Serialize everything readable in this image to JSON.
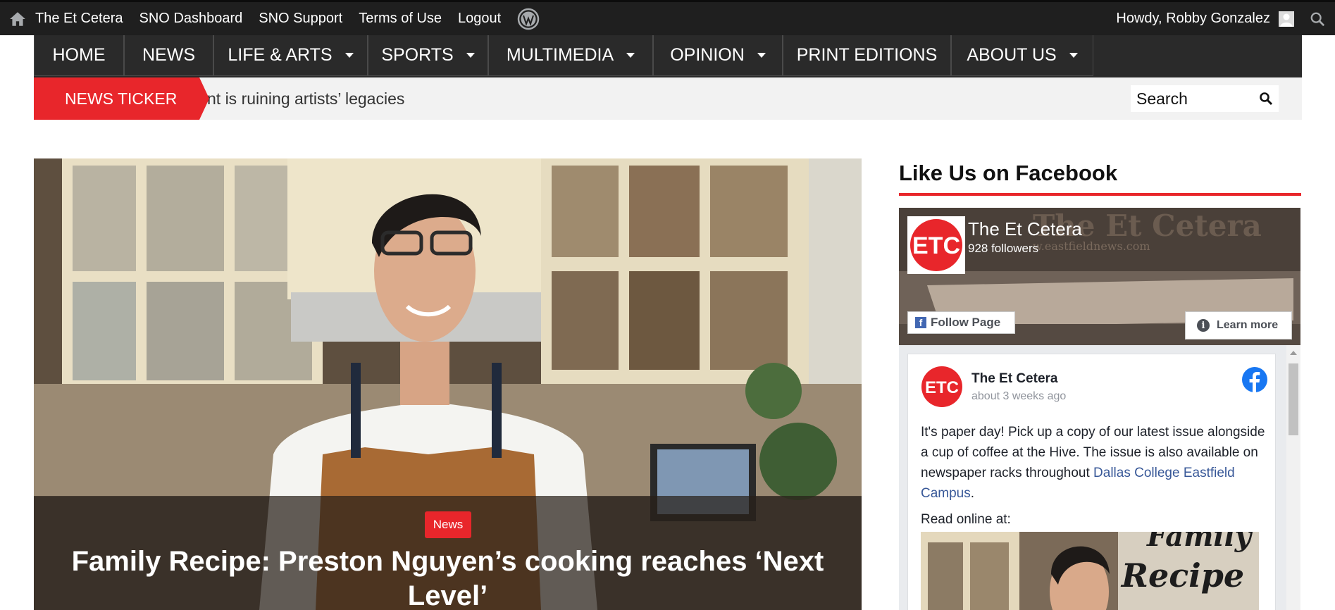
{
  "admin_bar": {
    "links": [
      "The Et Cetera",
      "SNO Dashboard",
      "SNO Support",
      "Terms of Use",
      "Logout"
    ],
    "greeting": "Howdy, Robby Gonzalez",
    "icons": [
      "home-icon",
      "wordpress-icon",
      "avatar",
      "search-icon"
    ]
  },
  "main_nav": {
    "items": [
      {
        "label": "HOME",
        "dropdown": false
      },
      {
        "label": "NEWS",
        "dropdown": false
      },
      {
        "label": "LIFE & ARTS",
        "dropdown": true
      },
      {
        "label": "SPORTS",
        "dropdown": true
      },
      {
        "label": "MULTIMEDIA",
        "dropdown": true
      },
      {
        "label": "OPINION",
        "dropdown": true
      },
      {
        "label": "PRINT EDITIONS",
        "dropdown": false
      },
      {
        "label": "ABOUT US",
        "dropdown": true
      }
    ]
  },
  "ticker": {
    "label": "NEWS TICKER",
    "text": "nt is ruining artists’ legacies"
  },
  "search": {
    "placeholder": "Search"
  },
  "hero": {
    "category": "News",
    "title": "Family Recipe: Preston Nguyen’s cooking reaches ‘Next Level’"
  },
  "sidebar": {
    "heading": "Like Us on Facebook",
    "facebook": {
      "page_name": "The Et Cetera",
      "followers": "928 followers",
      "logo_text": "ETC",
      "follow_label": "Follow Page",
      "learn_more_label": "Learn more",
      "post": {
        "author": "The Et Cetera",
        "time": "about 3 weeks ago",
        "text_before_link": "It's paper day! Pick up a copy of our latest issue alongside a cup of coffee at the Hive. The issue is also available on newspaper racks throughout ",
        "link_text": "Dallas College Eastfield Campus",
        "text_after_link": ".",
        "read_online": "Read online at:",
        "image_caption_1": "Family",
        "image_caption_2": "Recipe"
      }
    }
  },
  "colors": {
    "accent_red": "#e8262b",
    "nav_bg": "#2a2a2a",
    "admin_bg": "#1f1f1f",
    "facebook_blue": "#1877f2",
    "link_blue": "#385898"
  }
}
